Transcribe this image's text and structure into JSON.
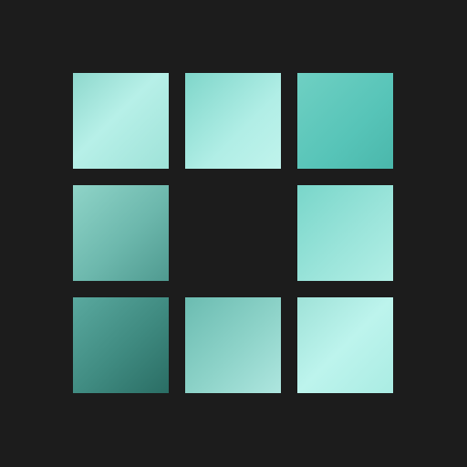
{
  "app_icon": {
    "background_color": "#1c1c1c",
    "grid": {
      "rows": 3,
      "columns": 3,
      "filled_cells": [
        "r1c1",
        "r1c2",
        "r1c3",
        "r2c1",
        "r2c3",
        "r3c1",
        "r3c2",
        "r3c3"
      ],
      "empty_cells": [
        "r2c2"
      ]
    },
    "tile_palette": [
      "#b7f0e8",
      "#9ee2d8",
      "#57c4b8",
      "#6db8ad",
      "#3f8a80",
      "#2a6d64"
    ]
  }
}
